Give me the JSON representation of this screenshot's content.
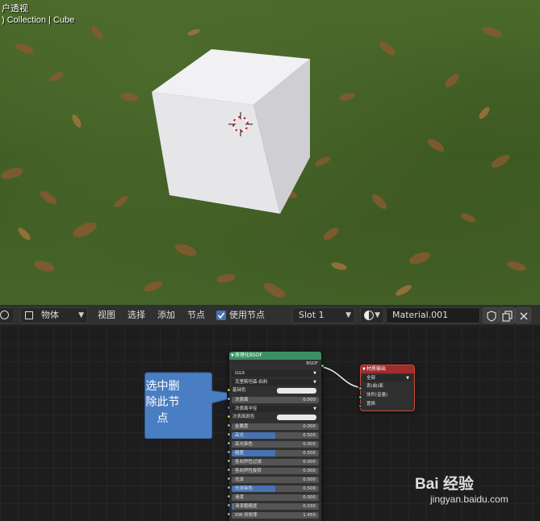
{
  "viewport": {
    "title": "户透视",
    "subtitle": ") Collection | Cube"
  },
  "header": {
    "mode_label": "物体",
    "menus": [
      "视图",
      "选择",
      "添加",
      "节点"
    ],
    "use_nodes_label": "使用节点",
    "use_nodes_checked": true,
    "slot_label": "Slot 1",
    "material_name": "Material.001"
  },
  "bsdf_node": {
    "title": "原理化BSDF",
    "output_label": "BSDF",
    "distribution": "GGX",
    "subsurface_method": "克里斯坦森-伯利",
    "base_color_label": "基础色",
    "rows": [
      {
        "label": "次表面",
        "value": "0.000",
        "fill": 0
      },
      {
        "label": "次表面半径",
        "type": "dropdown"
      },
      {
        "label": "次表面颜色",
        "type": "color"
      },
      {
        "label": "金属度",
        "value": "0.000",
        "fill": 0
      },
      {
        "label": "高光",
        "value": "0.500",
        "fill": 0.5
      },
      {
        "label": "高光染色",
        "value": "0.000",
        "fill": 0
      },
      {
        "label": "糙度",
        "value": "0.500",
        "fill": 0.5
      },
      {
        "label": "各向异性过滤",
        "value": "0.000",
        "fill": 0
      },
      {
        "label": "各向异性旋转",
        "value": "0.000",
        "fill": 0
      },
      {
        "label": "光泽",
        "value": "0.000",
        "fill": 0
      },
      {
        "label": "光泽染色",
        "value": "0.500",
        "fill": 0.5
      },
      {
        "label": "清漆",
        "value": "0.000",
        "fill": 0
      },
      {
        "label": "清漆粗糙度",
        "value": "0.030",
        "fill": 0.03
      },
      {
        "label": "IOR 折射率",
        "value": "1.450",
        "fill": 0
      }
    ]
  },
  "output_node": {
    "title": "材质输出",
    "target": "全部",
    "inputs": [
      "表(曲)面",
      "体积(音量)",
      "置换"
    ]
  },
  "callout": {
    "text_line1": "选中删",
    "text_line2": "除此节",
    "text_line3": "点"
  },
  "watermark": {
    "brand": "Bai 经验",
    "url": "jingyan.baidu.com"
  },
  "colors": {
    "bsdf_header": "#3a9063",
    "output_header": "#a12c2c",
    "accent_blue": "#4772b3",
    "callout_fill": "#4a7ec2",
    "socket_shader": "#63c763",
    "socket_color": "#c7c729",
    "socket_float": "#a1a1a1",
    "socket_vector": "#6363c7"
  }
}
